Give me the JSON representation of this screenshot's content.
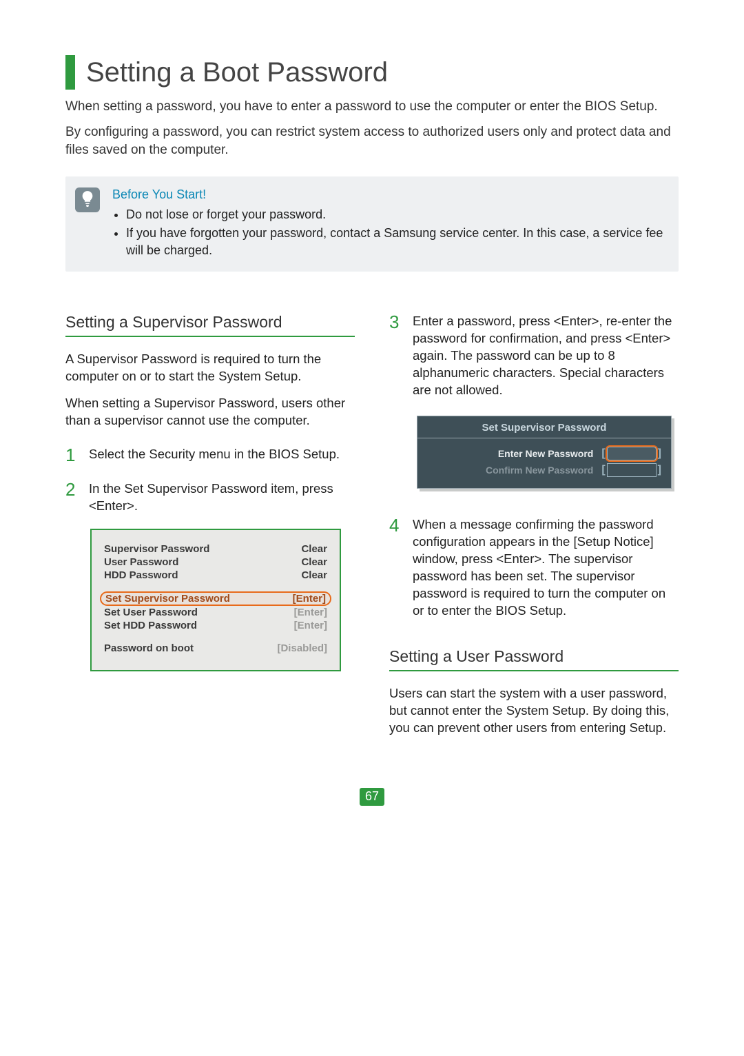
{
  "title": "Setting a Boot Password",
  "intro": [
    "When setting a password, you have to enter a password to use the computer or enter the BIOS Setup.",
    "By configuring a password, you can restrict system access to authorized users only and protect data and files saved on the computer."
  ],
  "note": {
    "heading": "Before You Start!",
    "items": [
      "Do not lose or forget your password.",
      "If you have forgotten your password, contact a Samsung service center. In this case, a service fee will be charged."
    ]
  },
  "left": {
    "section_title": "Setting a Supervisor Password",
    "para1": "A Supervisor Password is required to turn the computer on or to start the System Setup.",
    "para2": "When setting a Supervisor Password, users other than a supervisor cannot use the computer.",
    "step1": "Select the Security menu in the BIOS Setup.",
    "step2": "In the Set Supervisor Password item, press <Enter>.",
    "bios": {
      "rows": [
        {
          "label": "Supervisor Password",
          "value": "Clear",
          "dim": false
        },
        {
          "label": "User Password",
          "value": "Clear",
          "dim": false
        },
        {
          "label": "HDD Password",
          "value": "Clear",
          "dim": false
        }
      ],
      "rows2": [
        {
          "label": "Set Supervisor Password",
          "value": "[Enter]",
          "hl": true
        },
        {
          "label": "Set User Password",
          "value": "[Enter]",
          "dim": true
        },
        {
          "label": "Set HDD Password",
          "value": "[Enter]",
          "dim": true
        }
      ],
      "rows3": [
        {
          "label": "Password on boot",
          "value": "[Disabled]",
          "dim": true
        }
      ]
    }
  },
  "right": {
    "step3": "Enter a password, press <Enter>, re-enter the password for confirmation, and press <Enter> again. The password can be up to 8 alphanumeric characters. Special characters are not allowed.",
    "bios2": {
      "title": "Set Supervisor Password",
      "row1": "Enter New Password",
      "row2": "Confirm New Password"
    },
    "step4": "When a message confirming the password configuration appears in the [Setup Notice] window, press <Enter>. The supervisor password has been set. The supervisor password is required to turn the computer on or to enter the BIOS Setup.",
    "section_title": "Setting a User Password",
    "para": "Users can start the system with a user password, but cannot enter the System Setup. By doing this, you can prevent other users from entering Setup."
  },
  "step_numbers": {
    "s1": "1",
    "s2": "2",
    "s3": "3",
    "s4": "4"
  },
  "page_number": "67"
}
